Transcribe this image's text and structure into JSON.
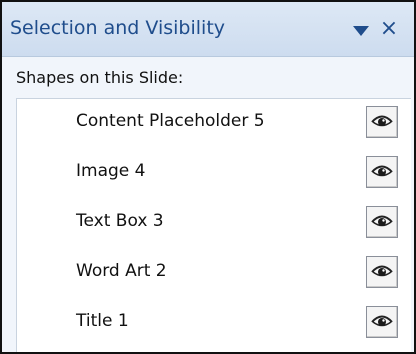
{
  "pane": {
    "title": "Selection and Visibility",
    "section_label": "Shapes on this Slide:",
    "icons": {
      "dropdown": "chevron-down-icon",
      "close": "close-icon",
      "visibility": "eye-icon"
    },
    "shapes": [
      {
        "label": "Content Placeholder 5",
        "visible": true
      },
      {
        "label": "Image 4",
        "visible": true
      },
      {
        "label": "Text Box 3",
        "visible": true
      },
      {
        "label": "Word Art 2",
        "visible": true
      },
      {
        "label": "Title 1",
        "visible": true
      }
    ]
  },
  "colors": {
    "title_text": "#1f4d8c",
    "title_bar": "#d6e3f3",
    "pane_background": "#f1f5fb"
  }
}
